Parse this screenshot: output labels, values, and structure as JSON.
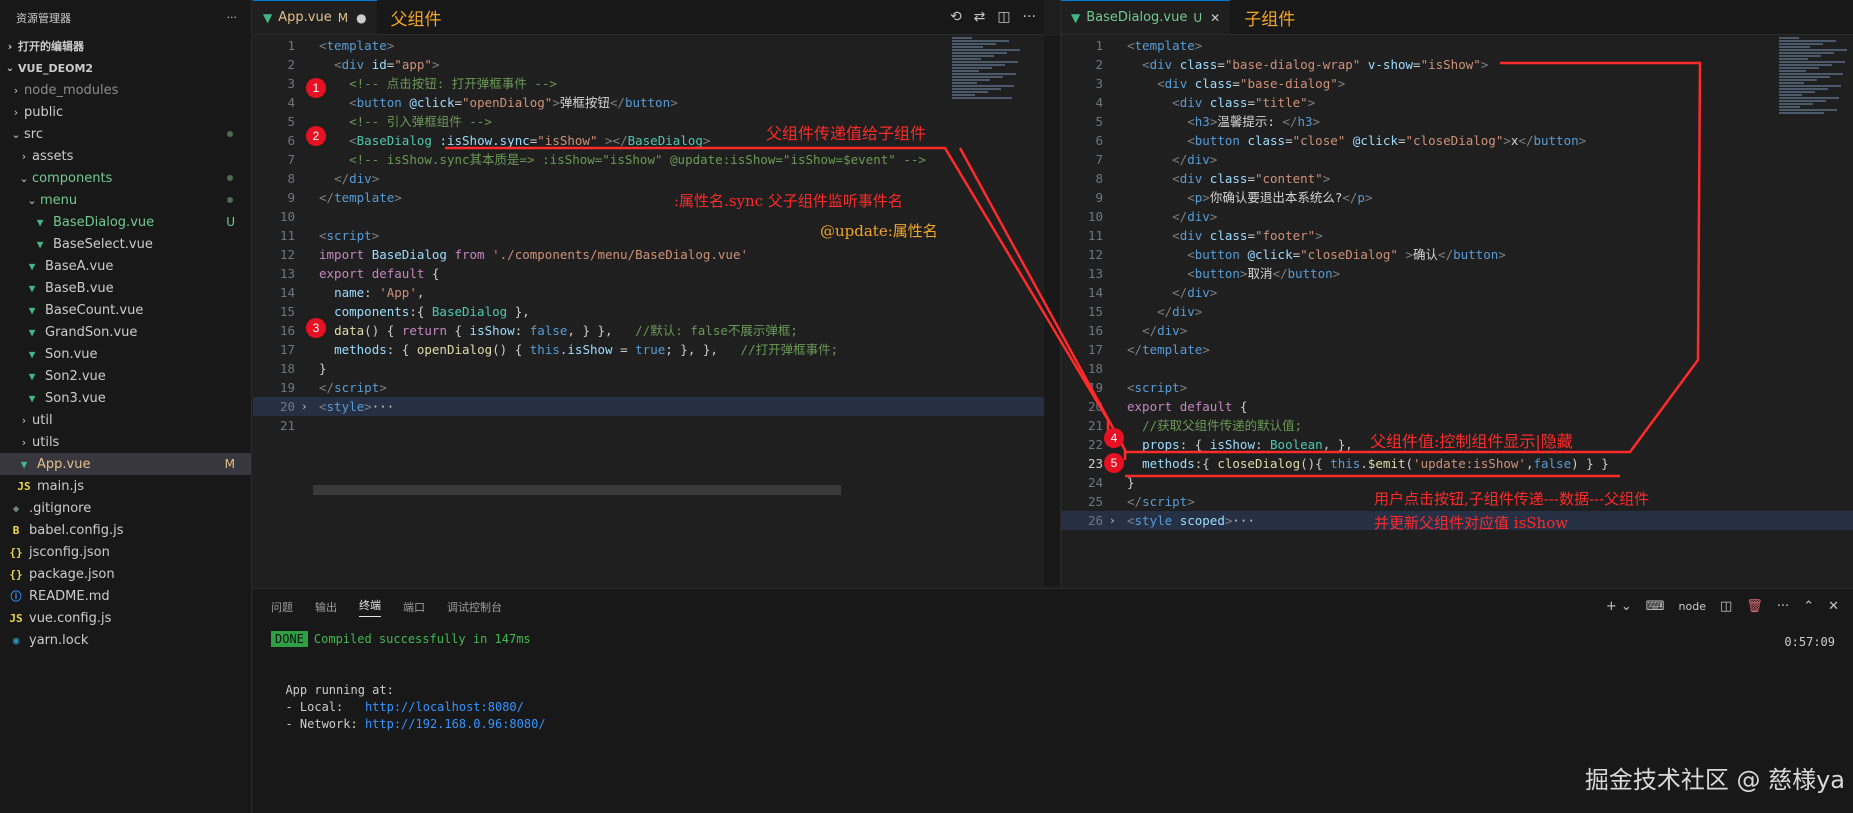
{
  "explorer": {
    "title": "资源管理器",
    "open_editors": "打开的编辑器",
    "project": "VUE_DEOM2",
    "tree": [
      {
        "label": "node_modules",
        "depth": 1,
        "type": "folder",
        "open": false,
        "color": "gray"
      },
      {
        "label": "public",
        "depth": 1,
        "type": "folder",
        "open": false
      },
      {
        "label": "src",
        "depth": 1,
        "type": "folder",
        "open": true,
        "dot": true
      },
      {
        "label": "assets",
        "depth": 2,
        "type": "folder",
        "open": false
      },
      {
        "label": "components",
        "depth": 2,
        "type": "folder",
        "open": true,
        "color": "green",
        "dot": true
      },
      {
        "label": "menu",
        "depth": 3,
        "type": "folder",
        "open": true,
        "color": "green",
        "dot": true
      },
      {
        "label": "BaseDialog.vue",
        "depth": 4,
        "type": "vue",
        "color": "green",
        "badge": "U"
      },
      {
        "label": "BaseSelect.vue",
        "depth": 4,
        "type": "vue"
      },
      {
        "label": "BaseA.vue",
        "depth": 3,
        "type": "vue"
      },
      {
        "label": "BaseB.vue",
        "depth": 3,
        "type": "vue"
      },
      {
        "label": "BaseCount.vue",
        "depth": 3,
        "type": "vue"
      },
      {
        "label": "GrandSon.vue",
        "depth": 3,
        "type": "vue"
      },
      {
        "label": "Son.vue",
        "depth": 3,
        "type": "vue"
      },
      {
        "label": "Son2.vue",
        "depth": 3,
        "type": "vue"
      },
      {
        "label": "Son3.vue",
        "depth": 3,
        "type": "vue"
      },
      {
        "label": "util",
        "depth": 2,
        "type": "folder",
        "open": false
      },
      {
        "label": "utils",
        "depth": 2,
        "type": "folder",
        "open": false
      },
      {
        "label": "App.vue",
        "depth": 2,
        "type": "vue",
        "color": "yellow",
        "badge": "M",
        "active": true
      },
      {
        "label": "main.js",
        "depth": 2,
        "type": "js"
      },
      {
        "label": ".gitignore",
        "depth": 1,
        "type": "git"
      },
      {
        "label": "babel.config.js",
        "depth": 1,
        "type": "babel"
      },
      {
        "label": "jsconfig.json",
        "depth": 1,
        "type": "json"
      },
      {
        "label": "package.json",
        "depth": 1,
        "type": "json"
      },
      {
        "label": "README.md",
        "depth": 1,
        "type": "info"
      },
      {
        "label": "vue.config.js",
        "depth": 1,
        "type": "js"
      },
      {
        "label": "yarn.lock",
        "depth": 1,
        "type": "yarn"
      }
    ]
  },
  "left_editor": {
    "tab_label": "App.vue",
    "tab_status": "M",
    "note": "父组件"
  },
  "right_editor": {
    "tab_label": "BaseDialog.vue",
    "tab_status": "U",
    "note": "子组件"
  },
  "left_code": [
    [
      [
        "t",
        "<"
      ],
      [
        "tg",
        "template"
      ],
      [
        "t",
        ">"
      ]
    ],
    [
      [
        "pl",
        "  "
      ],
      [
        "t",
        "<"
      ],
      [
        "tg",
        "div"
      ],
      [
        "pl",
        " "
      ],
      [
        "at",
        "id"
      ],
      [
        "pl",
        "="
      ],
      [
        "st",
        "\"app\""
      ],
      [
        "t",
        ">"
      ]
    ],
    [
      [
        "pl",
        "    "
      ],
      [
        "cm",
        "<!-- 点击按钮: 打开弹框事件 -->"
      ]
    ],
    [
      [
        "pl",
        "    "
      ],
      [
        "t",
        "<"
      ],
      [
        "tg",
        "button"
      ],
      [
        "pl",
        " "
      ],
      [
        "at",
        "@click"
      ],
      [
        "pl",
        "="
      ],
      [
        "st",
        "\"openDialog\""
      ],
      [
        "t",
        ">"
      ],
      [
        "tx",
        "弹框按钮"
      ],
      [
        "t",
        "</"
      ],
      [
        "tg",
        "button"
      ],
      [
        "t",
        ">"
      ]
    ],
    [
      [
        "pl",
        "    "
      ],
      [
        "cm",
        "<!-- 引入弹框组件 -->"
      ]
    ],
    [
      [
        "pl",
        "    "
      ],
      [
        "t",
        "<"
      ],
      [
        "cl",
        "BaseDialog"
      ],
      [
        "pl",
        " "
      ],
      [
        "at",
        ":isShow.sync"
      ],
      [
        "pl",
        "="
      ],
      [
        "st",
        "\"isShow\""
      ],
      [
        "pl",
        " "
      ],
      [
        "t",
        "></"
      ],
      [
        "cl",
        "BaseDialog"
      ],
      [
        "t",
        ">"
      ]
    ],
    [
      [
        "pl",
        "    "
      ],
      [
        "cm",
        "<!-- isShow.sync其本质是=> :isShow=\"isShow\" @update:isShow=\"isShow=$event\" -->"
      ]
    ],
    [
      [
        "pl",
        "  "
      ],
      [
        "t",
        "</"
      ],
      [
        "tg",
        "div"
      ],
      [
        "t",
        ">"
      ]
    ],
    [
      [
        "t",
        "</"
      ],
      [
        "tg",
        "template"
      ],
      [
        "t",
        ">"
      ]
    ],
    [],
    [
      [
        "t",
        "<"
      ],
      [
        "tg",
        "script"
      ],
      [
        "t",
        ">"
      ]
    ],
    [
      [
        "kw",
        "import"
      ],
      [
        "pl",
        " "
      ],
      [
        "pr",
        "BaseDialog"
      ],
      [
        "pl",
        " "
      ],
      [
        "kw",
        "from"
      ],
      [
        "pl",
        " "
      ],
      [
        "st",
        "'./components/menu/BaseDialog.vue'"
      ]
    ],
    [
      [
        "kw",
        "export"
      ],
      [
        "pl",
        " "
      ],
      [
        "kw",
        "default"
      ],
      [
        "pl",
        " {"
      ]
    ],
    [
      [
        "pl",
        "  "
      ],
      [
        "pr",
        "name"
      ],
      [
        "pl",
        ": "
      ],
      [
        "st",
        "'App'"
      ],
      [
        "pl",
        ","
      ]
    ],
    [
      [
        "pl",
        "  "
      ],
      [
        "pr",
        "components"
      ],
      [
        "pl",
        ":{ "
      ],
      [
        "cl",
        "BaseDialog"
      ],
      [
        "pl",
        " },"
      ]
    ],
    [
      [
        "pl",
        "  "
      ],
      [
        "fn",
        "data"
      ],
      [
        "pl",
        "() { "
      ],
      [
        "kw",
        "return"
      ],
      [
        "pl",
        " { "
      ],
      [
        "pr",
        "isShow"
      ],
      [
        "pl",
        ": "
      ],
      [
        "kb",
        "false"
      ],
      [
        "pl",
        ", } },   "
      ],
      [
        "cm",
        "//默认: false不展示弹框;"
      ]
    ],
    [
      [
        "pl",
        "  "
      ],
      [
        "pr",
        "methods"
      ],
      [
        "pl",
        ": { "
      ],
      [
        "fn",
        "openDialog"
      ],
      [
        "pl",
        "() { "
      ],
      [
        "kb",
        "this"
      ],
      [
        "pl",
        "."
      ],
      [
        "pr",
        "isShow"
      ],
      [
        "pl",
        " = "
      ],
      [
        "kb",
        "true"
      ],
      [
        "pl",
        "; }, },   "
      ],
      [
        "cm",
        "//打开弹框事件;"
      ]
    ],
    [
      [
        "pl",
        "}"
      ]
    ],
    [
      [
        "t",
        "</"
      ],
      [
        "tg",
        "script"
      ],
      [
        "t",
        ">"
      ]
    ],
    [
      [
        "t",
        "<"
      ],
      [
        "tg",
        "style"
      ],
      [
        "t",
        ">"
      ],
      [
        "pl",
        "···"
      ]
    ],
    []
  ],
  "right_code": [
    [
      [
        "t",
        "<"
      ],
      [
        "tg",
        "template"
      ],
      [
        "t",
        ">"
      ]
    ],
    [
      [
        "pl",
        "  "
      ],
      [
        "t",
        "<"
      ],
      [
        "tg",
        "div"
      ],
      [
        "pl",
        " "
      ],
      [
        "at",
        "class"
      ],
      [
        "pl",
        "="
      ],
      [
        "st",
        "\"base-dialog-wrap\""
      ],
      [
        "pl",
        " "
      ],
      [
        "at",
        "v-show"
      ],
      [
        "pl",
        "="
      ],
      [
        "st",
        "\"isShow\""
      ],
      [
        "t",
        ">"
      ]
    ],
    [
      [
        "pl",
        "    "
      ],
      [
        "t",
        "<"
      ],
      [
        "tg",
        "div"
      ],
      [
        "pl",
        " "
      ],
      [
        "at",
        "class"
      ],
      [
        "pl",
        "="
      ],
      [
        "st",
        "\"base-dialog\""
      ],
      [
        "t",
        ">"
      ]
    ],
    [
      [
        "pl",
        "      "
      ],
      [
        "t",
        "<"
      ],
      [
        "tg",
        "div"
      ],
      [
        "pl",
        " "
      ],
      [
        "at",
        "class"
      ],
      [
        "pl",
        "="
      ],
      [
        "st",
        "\"title\""
      ],
      [
        "t",
        ">"
      ]
    ],
    [
      [
        "pl",
        "        "
      ],
      [
        "t",
        "<"
      ],
      [
        "tg",
        "h3"
      ],
      [
        "t",
        ">"
      ],
      [
        "tx",
        "温馨提示: "
      ],
      [
        "t",
        "</"
      ],
      [
        "tg",
        "h3"
      ],
      [
        "t",
        ">"
      ]
    ],
    [
      [
        "pl",
        "        "
      ],
      [
        "t",
        "<"
      ],
      [
        "tg",
        "button"
      ],
      [
        "pl",
        " "
      ],
      [
        "at",
        "class"
      ],
      [
        "pl",
        "="
      ],
      [
        "st",
        "\"close\""
      ],
      [
        "pl",
        " "
      ],
      [
        "at",
        "@click"
      ],
      [
        "pl",
        "="
      ],
      [
        "st",
        "\"closeDialog\""
      ],
      [
        "t",
        ">"
      ],
      [
        "tx",
        "x"
      ],
      [
        "t",
        "</"
      ],
      [
        "tg",
        "button"
      ],
      [
        "t",
        ">"
      ]
    ],
    [
      [
        "pl",
        "      "
      ],
      [
        "t",
        "</"
      ],
      [
        "tg",
        "div"
      ],
      [
        "t",
        ">"
      ]
    ],
    [
      [
        "pl",
        "      "
      ],
      [
        "t",
        "<"
      ],
      [
        "tg",
        "div"
      ],
      [
        "pl",
        " "
      ],
      [
        "at",
        "class"
      ],
      [
        "pl",
        "="
      ],
      [
        "st",
        "\"content\""
      ],
      [
        "t",
        ">"
      ]
    ],
    [
      [
        "pl",
        "        "
      ],
      [
        "t",
        "<"
      ],
      [
        "tg",
        "p"
      ],
      [
        "t",
        ">"
      ],
      [
        "tx",
        "你确认要退出本系统么?"
      ],
      [
        "t",
        "</"
      ],
      [
        "tg",
        "p"
      ],
      [
        "t",
        ">"
      ]
    ],
    [
      [
        "pl",
        "      "
      ],
      [
        "t",
        "</"
      ],
      [
        "tg",
        "div"
      ],
      [
        "t",
        ">"
      ]
    ],
    [
      [
        "pl",
        "      "
      ],
      [
        "t",
        "<"
      ],
      [
        "tg",
        "div"
      ],
      [
        "pl",
        " "
      ],
      [
        "at",
        "class"
      ],
      [
        "pl",
        "="
      ],
      [
        "st",
        "\"footer\""
      ],
      [
        "t",
        ">"
      ]
    ],
    [
      [
        "pl",
        "        "
      ],
      [
        "t",
        "<"
      ],
      [
        "tg",
        "button"
      ],
      [
        "pl",
        " "
      ],
      [
        "at",
        "@click"
      ],
      [
        "pl",
        "="
      ],
      [
        "st",
        "\"closeDialog\""
      ],
      [
        "pl",
        " "
      ],
      [
        "t",
        ">"
      ],
      [
        "tx",
        "确认"
      ],
      [
        "t",
        "</"
      ],
      [
        "tg",
        "button"
      ],
      [
        "t",
        ">"
      ]
    ],
    [
      [
        "pl",
        "        "
      ],
      [
        "t",
        "<"
      ],
      [
        "tg",
        "button"
      ],
      [
        "t",
        ">"
      ],
      [
        "tx",
        "取消"
      ],
      [
        "t",
        "</"
      ],
      [
        "tg",
        "button"
      ],
      [
        "t",
        ">"
      ]
    ],
    [
      [
        "pl",
        "      "
      ],
      [
        "t",
        "</"
      ],
      [
        "tg",
        "div"
      ],
      [
        "t",
        ">"
      ]
    ],
    [
      [
        "pl",
        "    "
      ],
      [
        "t",
        "</"
      ],
      [
        "tg",
        "div"
      ],
      [
        "t",
        ">"
      ]
    ],
    [
      [
        "pl",
        "  "
      ],
      [
        "t",
        "</"
      ],
      [
        "tg",
        "div"
      ],
      [
        "t",
        ">"
      ]
    ],
    [
      [
        "t",
        "</"
      ],
      [
        "tg",
        "template"
      ],
      [
        "t",
        ">"
      ]
    ],
    [],
    [
      [
        "t",
        "<"
      ],
      [
        "tg",
        "script"
      ],
      [
        "t",
        ">"
      ]
    ],
    [
      [
        "kw",
        "export"
      ],
      [
        "pl",
        " "
      ],
      [
        "kw",
        "default"
      ],
      [
        "pl",
        " {"
      ]
    ],
    [
      [
        "pl",
        "  "
      ],
      [
        "cm",
        "//获取父组件传递的默认值;"
      ]
    ],
    [
      [
        "pl",
        "  "
      ],
      [
        "pr",
        "props"
      ],
      [
        "pl",
        ": { "
      ],
      [
        "pr",
        "isShow"
      ],
      [
        "pl",
        ": "
      ],
      [
        "cl",
        "Boolean"
      ],
      [
        "pl",
        ", },"
      ]
    ],
    [
      [
        "pl",
        "  "
      ],
      [
        "pr",
        "methods"
      ],
      [
        "pl",
        ":{ "
      ],
      [
        "fn",
        "closeDialog"
      ],
      [
        "pl",
        "(){ "
      ],
      [
        "kb",
        "this"
      ],
      [
        "pl",
        "."
      ],
      [
        "fn",
        "$emit"
      ],
      [
        "pl",
        "("
      ],
      [
        "st",
        "'update:isShow'"
      ],
      [
        "pl",
        ","
      ],
      [
        "kb",
        "false"
      ],
      [
        "pl",
        ") } }"
      ]
    ],
    [
      [
        "pl",
        "}"
      ]
    ],
    [
      [
        "t",
        "</"
      ],
      [
        "tg",
        "script"
      ],
      [
        "t",
        ">"
      ]
    ],
    [
      [
        "t",
        "<"
      ],
      [
        "tg",
        "style"
      ],
      [
        "pl",
        " "
      ],
      [
        "at",
        "scoped"
      ],
      [
        "t",
        ">"
      ],
      [
        "pl",
        "···"
      ]
    ]
  ],
  "panel": {
    "tabs": [
      "问题",
      "输出",
      "终端",
      "端口",
      "调试控制台"
    ],
    "active_tab": "终端",
    "terminal_name": "node",
    "done_label": "DONE",
    "compiled": "Compiled successfully in 147ms",
    "time": "0:57:09",
    "running": "App running at:",
    "local_label": "- Local:   ",
    "local_url": "http://localhost:8080/",
    "network_label": "- Network: ",
    "network_url": "http://192.168.0.96:8080/"
  },
  "annotations": {
    "parent_to_child": "父组件传递值给子组件",
    "sync_desc": ":属性名.sync 父子组件监听事件名",
    "update_desc": "@update:属性名",
    "child_value_desc": "父组件值:控制组件显示|隐藏",
    "emit_desc_1": "用户点击按钮,子组件传递---数据---父组件",
    "emit_desc_2": "并更新父组件对应值 isShow",
    "markers": [
      "1",
      "2",
      "3",
      "4",
      "5"
    ]
  },
  "watermark": "掘金技术社区 @ 慈様ya",
  "colors": {
    "annotation_red": "#ff2a2a",
    "vue_green": "#41b883",
    "git_modified": "#e2c08d",
    "git_untracked": "#73c991"
  }
}
